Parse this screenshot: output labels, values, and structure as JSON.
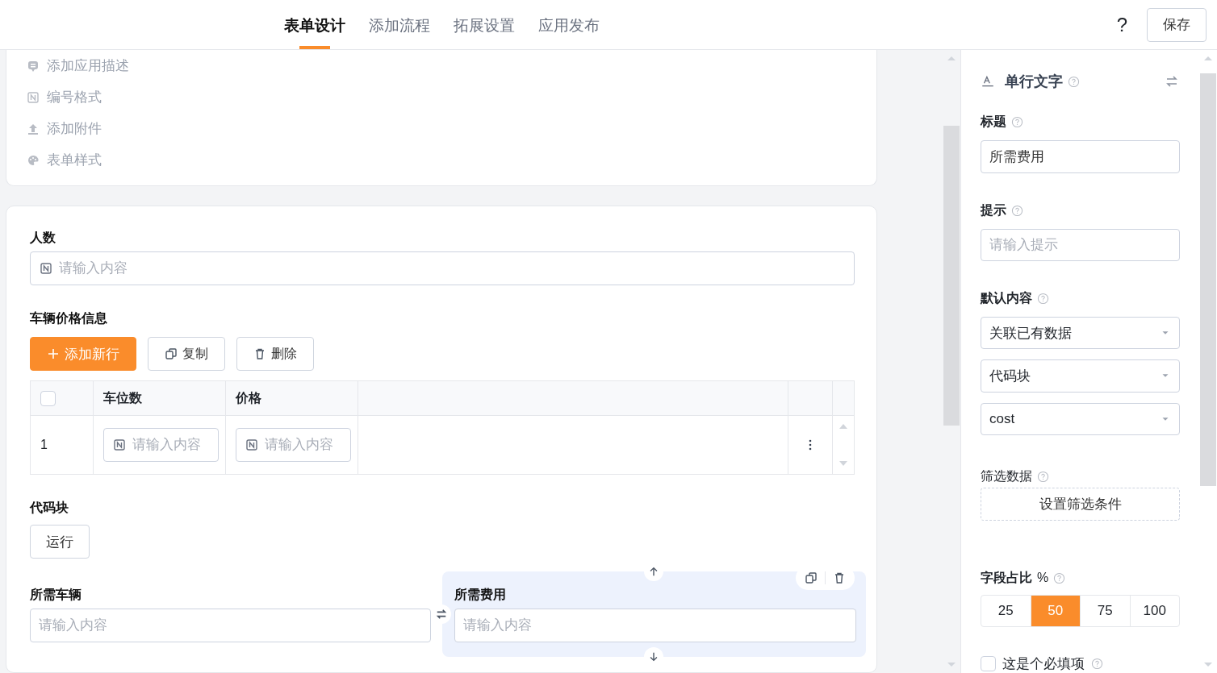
{
  "header": {
    "tabs": [
      {
        "label": "表单设计",
        "selected": true
      },
      {
        "label": "添加流程",
        "selected": false
      },
      {
        "label": "拓展设置",
        "selected": false
      },
      {
        "label": "应用发布",
        "selected": false
      }
    ],
    "help": "?",
    "save": "保存"
  },
  "settings_menu": [
    {
      "kind": "comment",
      "label": "添加应用描述"
    },
    {
      "kind": "number",
      "label": "编号格式"
    },
    {
      "kind": "upload",
      "label": "添加附件"
    },
    {
      "kind": "palette",
      "label": "表单样式"
    }
  ],
  "form": {
    "number_field": {
      "label": "人数",
      "placeholder": "请输入内容"
    },
    "subtable": {
      "label": "车辆价格信息",
      "buttons": [
        {
          "kind": "add",
          "label": "添加新行"
        },
        {
          "kind": "copy",
          "label": "复制"
        },
        {
          "kind": "delete",
          "label": "删除"
        }
      ],
      "select_all": {
        "checked": false
      },
      "columns": [
        "车位数",
        "价格"
      ],
      "rows": [
        {
          "index": "1",
          "cells": [
            {
              "placeholder": "请输入内容"
            },
            {
              "placeholder": "请输入内容"
            }
          ]
        }
      ]
    },
    "code_block": {
      "label": "代码块",
      "button": "运行"
    },
    "row_fields": [
      {
        "label": "所需车辆",
        "placeholder": "请输入内容",
        "selected": false
      },
      {
        "label": "所需费用",
        "placeholder": "请输入内容",
        "selected": true
      }
    ]
  },
  "panel": {
    "title": "单行文字",
    "title_field": {
      "label": "标题",
      "value": "所需费用"
    },
    "hint_field": {
      "label": "提示",
      "placeholder": "请输入提示"
    },
    "default_content": {
      "label": "默认内容",
      "selects": [
        "关联已有数据",
        "代码块",
        "cost"
      ]
    },
    "filter": {
      "label": "筛选数据",
      "button": "设置筛选条件"
    },
    "width": {
      "label": "字段占比",
      "unit": "%",
      "options": [
        {
          "label": "25",
          "selected": false
        },
        {
          "label": "50",
          "selected": true
        },
        {
          "label": "75",
          "selected": false
        },
        {
          "label": "100",
          "selected": false
        }
      ]
    },
    "required": {
      "label": "这是个必填项",
      "checked": false
    }
  }
}
